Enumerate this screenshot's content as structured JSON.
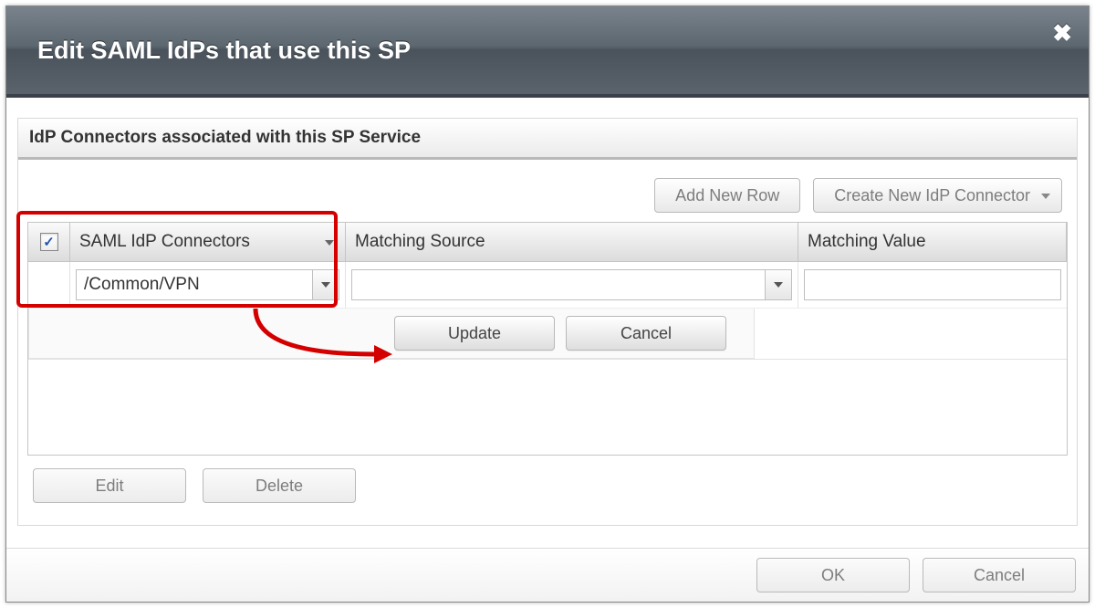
{
  "dialog": {
    "title": "Edit SAML IdPs that use this SP"
  },
  "panel": {
    "header": "IdP Connectors associated with this SP Service"
  },
  "toolbar": {
    "add_row": "Add New Row",
    "create_connector": "Create New IdP Connector"
  },
  "grid": {
    "columns": {
      "connectors": "SAML IdP Connectors",
      "source": "Matching Source",
      "value": "Matching Value"
    },
    "row": {
      "checked": true,
      "connector": "/Common/VPN",
      "source": "",
      "value": ""
    }
  },
  "inline_actions": {
    "update": "Update",
    "cancel": "Cancel"
  },
  "bottom_actions": {
    "edit": "Edit",
    "delete": "Delete"
  },
  "footer": {
    "ok": "OK",
    "cancel": "Cancel"
  }
}
